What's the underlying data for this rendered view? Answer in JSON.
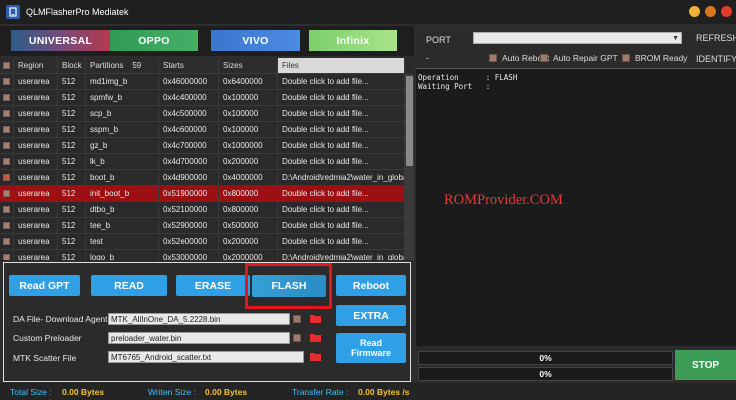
{
  "window": {
    "title": "QLMFlasherPro Mediatek",
    "controls": [
      {
        "name": "minimize",
        "color": "#f2b233"
      },
      {
        "name": "maximize",
        "color": "#d9771f"
      },
      {
        "name": "close",
        "color": "#e03b2b"
      }
    ]
  },
  "brands": [
    "UNIVERSAL",
    "OPPO",
    "VIVO",
    "Infinix"
  ],
  "table": {
    "headers": {
      "region": "Region",
      "block": "Block",
      "partitions": "Partitions",
      "partitions_count": "59",
      "starts": "Starts",
      "sizes": "Sizes",
      "files": "Files"
    },
    "rows": [
      {
        "region": "userarea",
        "block": "512",
        "name": "md1img_b",
        "start": "0x46000000",
        "size": "0x6400000",
        "file": "Double click to add file...",
        "checked": false,
        "selected": false
      },
      {
        "region": "userarea",
        "block": "512",
        "name": "spmfw_b",
        "start": "0x4c400000",
        "size": "0x100000",
        "file": "Double click to add file...",
        "checked": false,
        "selected": false
      },
      {
        "region": "userarea",
        "block": "512",
        "name": "scp_b",
        "start": "0x4c500000",
        "size": "0x100000",
        "file": "Double click to add file...",
        "checked": false,
        "selected": false
      },
      {
        "region": "userarea",
        "block": "512",
        "name": "sspm_b",
        "start": "0x4c600000",
        "size": "0x100000",
        "file": "Double click to add file...",
        "checked": false,
        "selected": false
      },
      {
        "region": "userarea",
        "block": "512",
        "name": "gz_b",
        "start": "0x4c700000",
        "size": "0x1000000",
        "file": "Double click to add file...",
        "checked": false,
        "selected": false
      },
      {
        "region": "userarea",
        "block": "512",
        "name": "lk_b",
        "start": "0x4d700000",
        "size": "0x200000",
        "file": "Double click to add file...",
        "checked": false,
        "selected": false
      },
      {
        "region": "userarea",
        "block": "512",
        "name": "boot_b",
        "start": "0x4d900000",
        "size": "0x4000000",
        "file": "D:\\Android\\redmia2\\water_in_globa",
        "checked": true,
        "selected": false
      },
      {
        "region": "userarea",
        "block": "512",
        "name": "init_boot_b",
        "start": "0x51900000",
        "size": "0x800000",
        "file": "Double click to add file...",
        "checked": false,
        "selected": true
      },
      {
        "region": "userarea",
        "block": "512",
        "name": "dtbo_b",
        "start": "0x52100000",
        "size": "0x800000",
        "file": "Double click to add file...",
        "checked": false,
        "selected": false
      },
      {
        "region": "userarea",
        "block": "512",
        "name": "tee_b",
        "start": "0x52900000",
        "size": "0x500000",
        "file": "Double click to add file...",
        "checked": false,
        "selected": false
      },
      {
        "region": "userarea",
        "block": "512",
        "name": "test",
        "start": "0x52e00000",
        "size": "0x200000",
        "file": "Double click to add file...",
        "checked": false,
        "selected": false
      },
      {
        "region": "userarea",
        "block": "512",
        "name": "logo_b",
        "start": "0x53000000",
        "size": "0x2000000",
        "file": "D:\\Android\\redmia2\\water_in_globa",
        "checked": false,
        "selected": false
      }
    ]
  },
  "buttons": {
    "read_gpt": "Read GPT",
    "read": "READ",
    "erase": "ERASE",
    "flash": "FLASH",
    "reboot": "Reboot",
    "extra": "EXTRA",
    "read_firmware_1": "Read",
    "read_firmware_2": "Firmware"
  },
  "files": {
    "da_label": "DA File- Download Agent",
    "da_value": "MTK_AllInOne_DA_5.2228.bin",
    "preloader_label": "Custom Preloader",
    "preloader_value": "preloader_water.bin",
    "scatter_label": "MTK Scatter File",
    "scatter_value": "MT6765_Android_scatter.txt"
  },
  "status": {
    "total_label": "Total Size :",
    "total_value": "0.00 Bytes",
    "written_label": "Writen Size :",
    "written_value": "0.00 Bytes",
    "rate_label": "Transfer Rate :",
    "rate_value": "0.00 Bytes /s"
  },
  "right": {
    "port_label": "PORT",
    "port_value": "",
    "refresh": "REFRESH",
    "identify": "IDENTIFY",
    "dash": "-",
    "auto_reboot": "Auto Reboot",
    "auto_repair": "Auto Repair GPT",
    "brom_ready": "BROM Ready",
    "log": [
      "Operation      : FLASH",
      "Waiting Port   :"
    ],
    "watermark": "ROMProvider.COM",
    "progress1": {
      "text": "0%",
      "value": 0
    },
    "progress2": {
      "text": "0%",
      "value": 0
    },
    "stop": "STOP"
  }
}
